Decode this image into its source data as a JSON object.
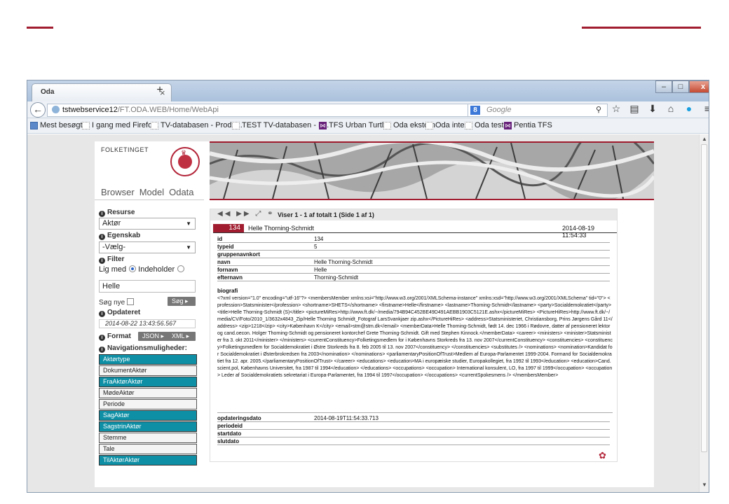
{
  "browser": {
    "tab_title": "Oda",
    "tab_close": "×",
    "new_tab": "+",
    "url_host": "tstwebservice12",
    "url_path": "/FT.ODA.WEB/Home/WebApi",
    "search_placeholder": "Google",
    "bookmarks": [
      "Mest besøgte",
      "I gang med Firefox",
      "TV-databasen - Produ...",
      "TEST TV-databasen - P...",
      "TFS Urban Turtle",
      "Oda ekstern",
      "Oda intern",
      "Oda test",
      "Pentia TFS"
    ]
  },
  "site": {
    "brand": "FOLKETINGET",
    "nav": [
      "Browser",
      "Model",
      "Odata"
    ]
  },
  "left": {
    "resurse_label": "Resurse",
    "resurse_value": "Aktør",
    "egenskab_label": "Egenskab",
    "egenskab_value": "-Vælg-",
    "filter_label": "Filter",
    "lig_med": "Lig med",
    "indeholder": "Indeholder",
    "filter_value": "Helle",
    "soeg_nye": "Søg nye",
    "soeg_button": "Søg",
    "opdateret_label": "Opdateret",
    "opdateret_value": "2014-08-22 13:43:56.567",
    "format_label": "Format",
    "json": "JSON",
    "xml": "XML",
    "nav_label": "Navigationsmuligheder:",
    "nav_items": [
      {
        "label": "Aktørtype",
        "active": true
      },
      {
        "label": "DokumentAktør",
        "active": false
      },
      {
        "label": "FraAktørAktør",
        "active": true
      },
      {
        "label": "MødeAktør",
        "active": false
      },
      {
        "label": "Periode",
        "active": false
      },
      {
        "label": "SagAktør",
        "active": true
      },
      {
        "label": "SagstrinAktør",
        "active": true
      },
      {
        "label": "Stemme",
        "active": false
      },
      {
        "label": "Tale",
        "active": false
      },
      {
        "label": "TilAktørAktør",
        "active": true
      }
    ]
  },
  "record": {
    "count_text": "Viser 1 - 1 af totalt 1 (Side 1 af 1)",
    "id_badge": "134",
    "name": "Helle Thorning-Schmidt",
    "date": "2014-08-19 11:54:33",
    "fields": [
      {
        "key": "id",
        "value": "134"
      },
      {
        "key": "typeid",
        "value": "5"
      },
      {
        "key": "gruppenavnkort",
        "value": ""
      },
      {
        "key": "navn",
        "value": "Helle Thorning-Schmidt"
      },
      {
        "key": "fornavn",
        "value": "Helle"
      },
      {
        "key": "efternavn",
        "value": "Thorning-Schmidt"
      }
    ],
    "bio_label": "biografi",
    "bio_text": "<?xml version=\"1.0\" encoding=\"utf-16\"?> <membersMember xmlns:xsi=\"http://www.w3.org/2001/XMLSchema-instance\" xmlns:xsd=\"http://www.w3.org/2001/XMLSchema\" tid=\"0\"> <profession>Statsminister</profession> <shortname>SHETS</shortname> <firstname>Helle</firstname> <lastname>Thorning-Schmidt</lastname> <party>Socialdemokratiet</party> <title>Helle Thorning-Schmidt (S)</title> <pictureMiRes>http://www.ft.dk/~/media/794B94C452BE49D491AEBB1903C5121E.ashx</pictureMiRes> <PictureHiRes>http://www.ft.dk/~/media/CV/Foto/2010_1/3632x4843_Zip/Helle Thorning Schmidt_Fotograf LarsSvankjaer zip.ashx</PictureHiRes> <address>Statsministeriet, Christiansborg, Prins Jørgens Gård 11</address> <zip>1218</zip> <city>København K</city> <email>stm@stm.dk</email> <memberData>Helle Thorning-Schmidt, født 14. dec 1966 i Rødovre, datter af pensioneret lektor og cand.oecon. Holger Thorning-Schmidt og pensioneret kontorchef Grete Thorning-Schmidt. Gift med Stephen Kinnock.</memberData> <career> <ministers> <minister>Statsminister fra 3. okt 2011</minister> </ministers> <currentConstituency>Folketingsmedlem for i Københavns Storkreds fra 13. nov 2007</currentConstituency> <constituencies> <constituency>Folketingsmedlem for Socialdemokratiet i Østre Storkreds fra 8. feb 2005 til 13. nov 2007</constituency> </constituencies> <substitutes /> <nominations> <nomination>Kandidat for Socialdemokratiet i Østerbrokredsen fra 2003</nomination> </nominations> <parliamentaryPositionOfTrust>Medlem af Europa-Parlamentet 1999-2004. Formand for Socialdemokratiet fra 12. apr. 2005.</parliamentaryPositionOfTrust> </career> <educations> <education>MA i europæiske studier, Europakollegiet, fra 1992 til 1993</education> <education>Cand.scient.pol, Københavns Universitet, fra 1987 til 1994</education> </educations> <occupations> <occupation> International konsulent, LO, fra 1997 til 1999</occupation> <occupation> Leder af Socialdemokratiets sekretariat i Europa-Parlamentet, fra 1994 til 1997</occupation> </occupations> <currentSpokesmens /> </membersMember>",
    "fields_after": [
      {
        "key": "opdateringsdato",
        "value": "2014-08-19T11:54:33.713"
      },
      {
        "key": "periodeid",
        "value": ""
      },
      {
        "key": "startdato",
        "value": ""
      },
      {
        "key": "slutdato",
        "value": ""
      }
    ]
  }
}
